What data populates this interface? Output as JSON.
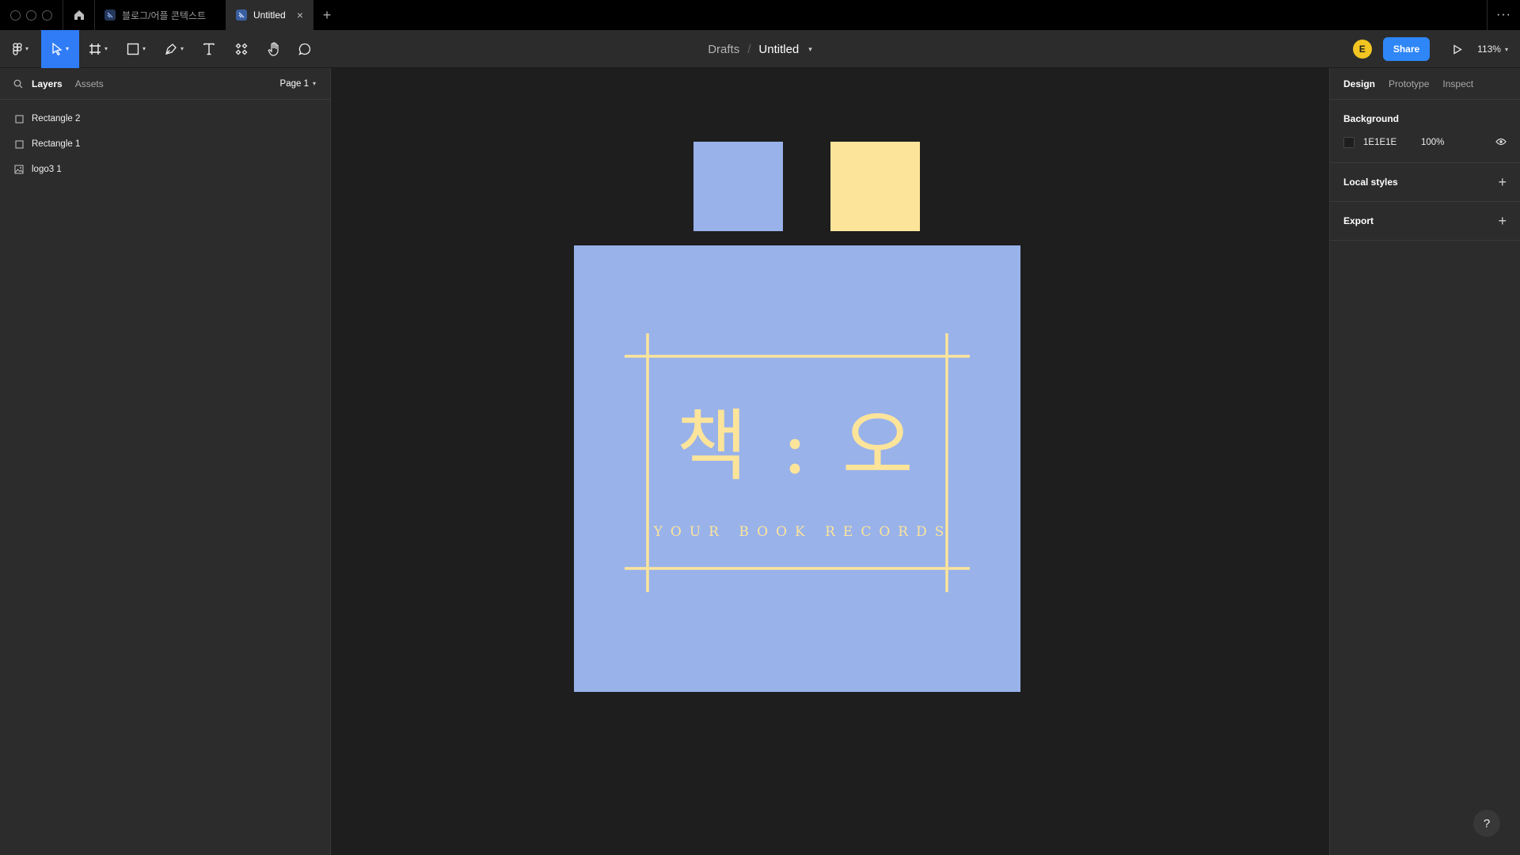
{
  "titlebar": {
    "tabs": [
      {
        "label": "블로그/어플 콘텍스트",
        "active": false
      },
      {
        "label": "Untitled",
        "active": true
      }
    ],
    "close_glyph": "×",
    "new_tab_glyph": "+",
    "more_glyph": "···"
  },
  "toolbar": {
    "tools": [
      "main-menu",
      "move",
      "frame",
      "rectangle",
      "pen",
      "text",
      "resources",
      "hand",
      "comment"
    ],
    "active_tool": "move",
    "breadcrumb": {
      "folder": "Drafts",
      "separator": "/",
      "file": "Untitled"
    },
    "avatar_initial": "E",
    "share_label": "Share",
    "zoom": "113%"
  },
  "left_panel": {
    "tabs": [
      {
        "label": "Layers",
        "active": true
      },
      {
        "label": "Assets",
        "active": false
      }
    ],
    "page": "Page 1",
    "layers": [
      {
        "name": "Rectangle 2",
        "type": "rectangle"
      },
      {
        "name": "Rectangle 1",
        "type": "rectangle"
      },
      {
        "name": "logo3 1",
        "type": "image"
      }
    ]
  },
  "canvas": {
    "background": "#1e1e1e",
    "rect_colors": [
      "#99b2ea",
      "#fce49a"
    ],
    "logo": {
      "background": "#99b2ea",
      "ink": "#fce49a",
      "title": "책 : 오",
      "subtitle": "YOUR BOOK RECORDS"
    }
  },
  "right_panel": {
    "tabs": [
      {
        "label": "Design",
        "active": true
      },
      {
        "label": "Prototype",
        "active": false
      },
      {
        "label": "Inspect",
        "active": false
      }
    ],
    "background": {
      "title": "Background",
      "hex": "1E1E1E",
      "opacity": "100%"
    },
    "local_styles": "Local styles",
    "export": "Export",
    "plus_glyph": "+"
  },
  "help_glyph": "?"
}
